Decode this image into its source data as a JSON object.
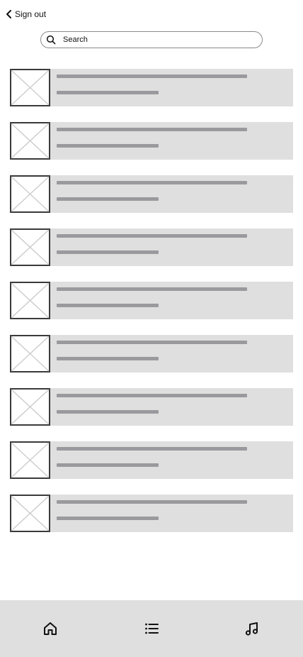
{
  "header": {
    "back_label": "Sign out",
    "back_icon": "chevron-left-icon"
  },
  "search": {
    "placeholder": "Search",
    "value": "",
    "icon": "search-icon"
  },
  "list": {
    "item_count": 9,
    "items": [
      {
        "thumbnail": "image-placeholder-icon"
      },
      {
        "thumbnail": "image-placeholder-icon"
      },
      {
        "thumbnail": "image-placeholder-icon"
      },
      {
        "thumbnail": "image-placeholder-icon"
      },
      {
        "thumbnail": "image-placeholder-icon"
      },
      {
        "thumbnail": "image-placeholder-icon"
      },
      {
        "thumbnail": "image-placeholder-icon"
      },
      {
        "thumbnail": "image-placeholder-icon"
      },
      {
        "thumbnail": "image-placeholder-icon"
      }
    ]
  },
  "tabbar": {
    "tabs": [
      {
        "name": "home",
        "icon": "home-icon"
      },
      {
        "name": "list",
        "icon": "list-icon"
      },
      {
        "name": "music",
        "icon": "music-note-icon"
      }
    ]
  },
  "colors": {
    "background": "#ffffff",
    "row_background": "#dfdfdf",
    "placeholder_line": "#9a9a9e",
    "tabbar_background": "#dfdfdf",
    "thumb_border": "#3a3a3a",
    "thumb_cross": "#c8c8c8"
  }
}
